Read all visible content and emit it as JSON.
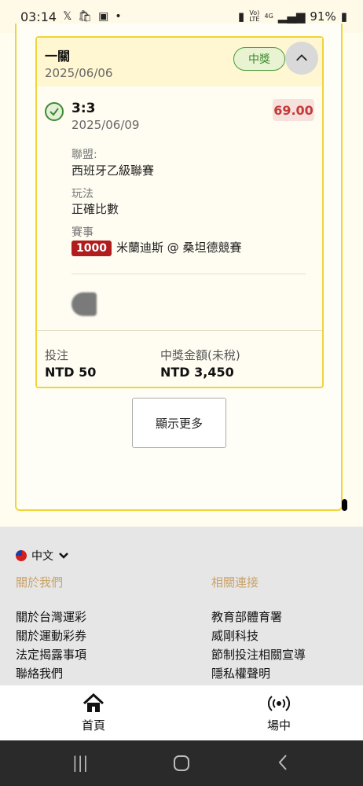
{
  "status_bar": {
    "time": "03:14",
    "battery": "91%",
    "net": "4G"
  },
  "bet": {
    "stage": "一關",
    "date": "2025/06/06",
    "result_badge": "中獎",
    "score": "3:3",
    "match_date": "2025/06/09",
    "odds": "69.00",
    "league_label": "聯盟:",
    "league": "西班牙乙級聯賽",
    "market_label": "玩法",
    "market": "正確比數",
    "event_label": "賽事",
    "event_code": "1000",
    "event_name": "米蘭迪斯 @ 桑坦德競賽",
    "stake_label": "投注",
    "stake": "NTD 50",
    "payout_label": "中獎金額(未稅)",
    "payout": "NTD 3,450"
  },
  "show_more": "顯示更多",
  "footer": {
    "language": "中文",
    "about_title": "關於我們",
    "related_title": "相關連接",
    "about_links": [
      "關於台灣運彩",
      "關於運動彩券",
      "法定揭露事項",
      "聯絡我們"
    ],
    "related_links": [
      "教育部體育署",
      "威剛科技",
      "節制投注相關宣導",
      "隱私權聲明"
    ]
  },
  "bottom_nav": {
    "home": "首頁",
    "live": "場中"
  },
  "colors": {
    "accent": "#f0d43a",
    "win_green": "#3a8a2c",
    "odds_red": "#c23a3a",
    "event_red": "#b11d1d",
    "link_gold": "#c9a36a"
  }
}
